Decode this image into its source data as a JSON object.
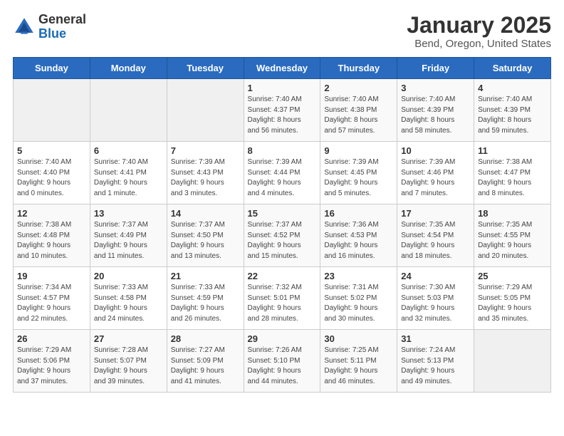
{
  "header": {
    "logo_general": "General",
    "logo_blue": "Blue",
    "title": "January 2025",
    "subtitle": "Bend, Oregon, United States"
  },
  "days_of_week": [
    "Sunday",
    "Monday",
    "Tuesday",
    "Wednesday",
    "Thursday",
    "Friday",
    "Saturday"
  ],
  "weeks": [
    [
      {
        "day": "",
        "info": ""
      },
      {
        "day": "",
        "info": ""
      },
      {
        "day": "",
        "info": ""
      },
      {
        "day": "1",
        "info": "Sunrise: 7:40 AM\nSunset: 4:37 PM\nDaylight: 8 hours\nand 56 minutes."
      },
      {
        "day": "2",
        "info": "Sunrise: 7:40 AM\nSunset: 4:38 PM\nDaylight: 8 hours\nand 57 minutes."
      },
      {
        "day": "3",
        "info": "Sunrise: 7:40 AM\nSunset: 4:39 PM\nDaylight: 8 hours\nand 58 minutes."
      },
      {
        "day": "4",
        "info": "Sunrise: 7:40 AM\nSunset: 4:39 PM\nDaylight: 8 hours\nand 59 minutes."
      }
    ],
    [
      {
        "day": "5",
        "info": "Sunrise: 7:40 AM\nSunset: 4:40 PM\nDaylight: 9 hours\nand 0 minutes."
      },
      {
        "day": "6",
        "info": "Sunrise: 7:40 AM\nSunset: 4:41 PM\nDaylight: 9 hours\nand 1 minute."
      },
      {
        "day": "7",
        "info": "Sunrise: 7:39 AM\nSunset: 4:43 PM\nDaylight: 9 hours\nand 3 minutes."
      },
      {
        "day": "8",
        "info": "Sunrise: 7:39 AM\nSunset: 4:44 PM\nDaylight: 9 hours\nand 4 minutes."
      },
      {
        "day": "9",
        "info": "Sunrise: 7:39 AM\nSunset: 4:45 PM\nDaylight: 9 hours\nand 5 minutes."
      },
      {
        "day": "10",
        "info": "Sunrise: 7:39 AM\nSunset: 4:46 PM\nDaylight: 9 hours\nand 7 minutes."
      },
      {
        "day": "11",
        "info": "Sunrise: 7:38 AM\nSunset: 4:47 PM\nDaylight: 9 hours\nand 8 minutes."
      }
    ],
    [
      {
        "day": "12",
        "info": "Sunrise: 7:38 AM\nSunset: 4:48 PM\nDaylight: 9 hours\nand 10 minutes."
      },
      {
        "day": "13",
        "info": "Sunrise: 7:37 AM\nSunset: 4:49 PM\nDaylight: 9 hours\nand 11 minutes."
      },
      {
        "day": "14",
        "info": "Sunrise: 7:37 AM\nSunset: 4:50 PM\nDaylight: 9 hours\nand 13 minutes."
      },
      {
        "day": "15",
        "info": "Sunrise: 7:37 AM\nSunset: 4:52 PM\nDaylight: 9 hours\nand 15 minutes."
      },
      {
        "day": "16",
        "info": "Sunrise: 7:36 AM\nSunset: 4:53 PM\nDaylight: 9 hours\nand 16 minutes."
      },
      {
        "day": "17",
        "info": "Sunrise: 7:35 AM\nSunset: 4:54 PM\nDaylight: 9 hours\nand 18 minutes."
      },
      {
        "day": "18",
        "info": "Sunrise: 7:35 AM\nSunset: 4:55 PM\nDaylight: 9 hours\nand 20 minutes."
      }
    ],
    [
      {
        "day": "19",
        "info": "Sunrise: 7:34 AM\nSunset: 4:57 PM\nDaylight: 9 hours\nand 22 minutes."
      },
      {
        "day": "20",
        "info": "Sunrise: 7:33 AM\nSunset: 4:58 PM\nDaylight: 9 hours\nand 24 minutes."
      },
      {
        "day": "21",
        "info": "Sunrise: 7:33 AM\nSunset: 4:59 PM\nDaylight: 9 hours\nand 26 minutes."
      },
      {
        "day": "22",
        "info": "Sunrise: 7:32 AM\nSunset: 5:01 PM\nDaylight: 9 hours\nand 28 minutes."
      },
      {
        "day": "23",
        "info": "Sunrise: 7:31 AM\nSunset: 5:02 PM\nDaylight: 9 hours\nand 30 minutes."
      },
      {
        "day": "24",
        "info": "Sunrise: 7:30 AM\nSunset: 5:03 PM\nDaylight: 9 hours\nand 32 minutes."
      },
      {
        "day": "25",
        "info": "Sunrise: 7:29 AM\nSunset: 5:05 PM\nDaylight: 9 hours\nand 35 minutes."
      }
    ],
    [
      {
        "day": "26",
        "info": "Sunrise: 7:29 AM\nSunset: 5:06 PM\nDaylight: 9 hours\nand 37 minutes."
      },
      {
        "day": "27",
        "info": "Sunrise: 7:28 AM\nSunset: 5:07 PM\nDaylight: 9 hours\nand 39 minutes."
      },
      {
        "day": "28",
        "info": "Sunrise: 7:27 AM\nSunset: 5:09 PM\nDaylight: 9 hours\nand 41 minutes."
      },
      {
        "day": "29",
        "info": "Sunrise: 7:26 AM\nSunset: 5:10 PM\nDaylight: 9 hours\nand 44 minutes."
      },
      {
        "day": "30",
        "info": "Sunrise: 7:25 AM\nSunset: 5:11 PM\nDaylight: 9 hours\nand 46 minutes."
      },
      {
        "day": "31",
        "info": "Sunrise: 7:24 AM\nSunset: 5:13 PM\nDaylight: 9 hours\nand 49 minutes."
      },
      {
        "day": "",
        "info": ""
      }
    ]
  ]
}
